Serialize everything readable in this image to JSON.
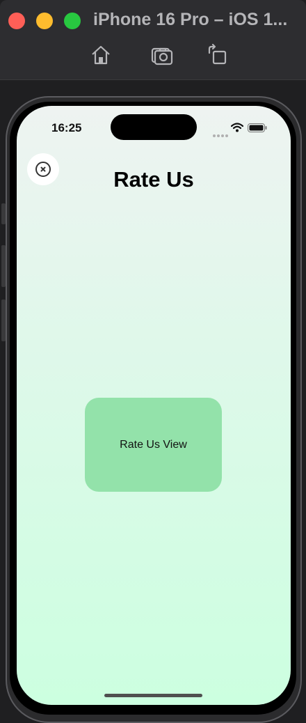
{
  "window": {
    "title": "iPhone 16 Pro – iOS 1...",
    "toolbar": [
      {
        "icon": "home-icon"
      },
      {
        "icon": "screenshot-camera-icon"
      },
      {
        "icon": "rotate-icon"
      }
    ]
  },
  "status_bar": {
    "time": "16:25"
  },
  "screen": {
    "title": "Rate Us",
    "close_icon": "close-circle-icon",
    "card_label": "Rate Us View",
    "colors": {
      "gradient_top": "#eef3f1",
      "gradient_bottom": "#ccffe0",
      "card": "#93e2aa"
    }
  }
}
